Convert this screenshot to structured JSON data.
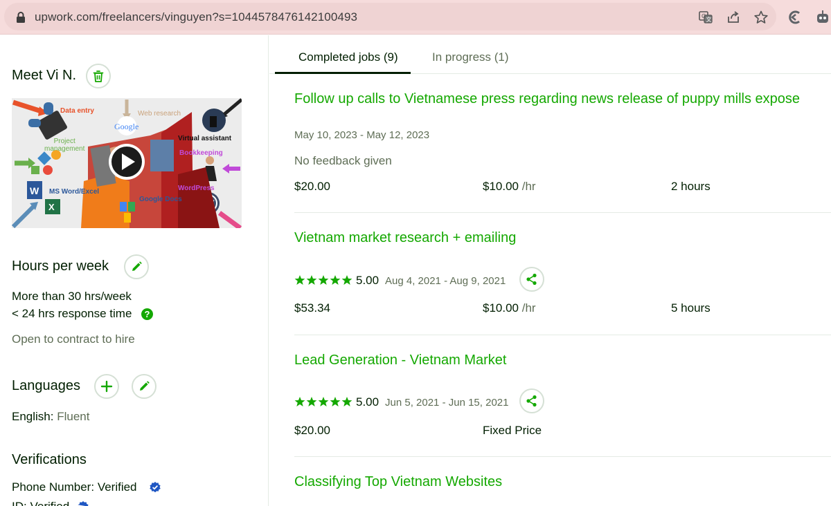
{
  "browser": {
    "url": "upwork.com/freelancers/vinguyen?s=1044578476142100493"
  },
  "profile": {
    "meet_title": "Meet Vi N.",
    "video_labels": {
      "data_entry": "Data entry",
      "web_research": "Web research",
      "project_management": "Project\nmanagement",
      "virtual_assistant": "Virtual assistant",
      "bookkeeping": "Bookkeeping",
      "ms_word_excel": "MS Word/Excel",
      "wordpress": "WordPress",
      "google_docs": "Google Docs",
      "google": "Google"
    },
    "hours": {
      "title": "Hours per week",
      "value": "More than 30 hrs/week",
      "response": "< 24 hrs response time",
      "contract": "Open to contract to hire"
    },
    "languages": {
      "title": "Languages",
      "language": "English:",
      "level": "Fluent"
    },
    "verifications": {
      "title": "Verifications",
      "phone_label": "Phone Number:",
      "phone_value": "Verified",
      "id_label": "ID:",
      "id_value": "Verified"
    }
  },
  "tabs": {
    "completed": "Completed jobs (9)",
    "in_progress": "In progress (1)"
  },
  "jobs": [
    {
      "title": "Follow up calls to Vietnamese press regarding news release of puppy mills expose",
      "dates": "May 10, 2023 - May 12, 2023",
      "feedback": "No feedback given",
      "earned": "$20.00",
      "rate": "$10.00",
      "rate_unit": "/hr",
      "hours": "2 hours"
    },
    {
      "title": "Vietnam market research + emailing",
      "rating": "5.00",
      "stars": 5,
      "dates": "Aug 4, 2021 - Aug 9, 2021",
      "earned": "$53.34",
      "rate": "$10.00",
      "rate_unit": "/hr",
      "hours": "5 hours"
    },
    {
      "title": "Lead Generation - Vietnam Market",
      "rating": "5.00",
      "stars": 5,
      "dates": "Jun 5, 2021 - Jun 15, 2021",
      "earned": "$20.00",
      "price_type": "Fixed Price"
    },
    {
      "title": "Classifying Top Vietnam Websites"
    }
  ],
  "colors": {
    "green": "#14a800",
    "text": "#001e00",
    "muted": "#5e6d55",
    "verified_blue": "#1f57c3"
  }
}
